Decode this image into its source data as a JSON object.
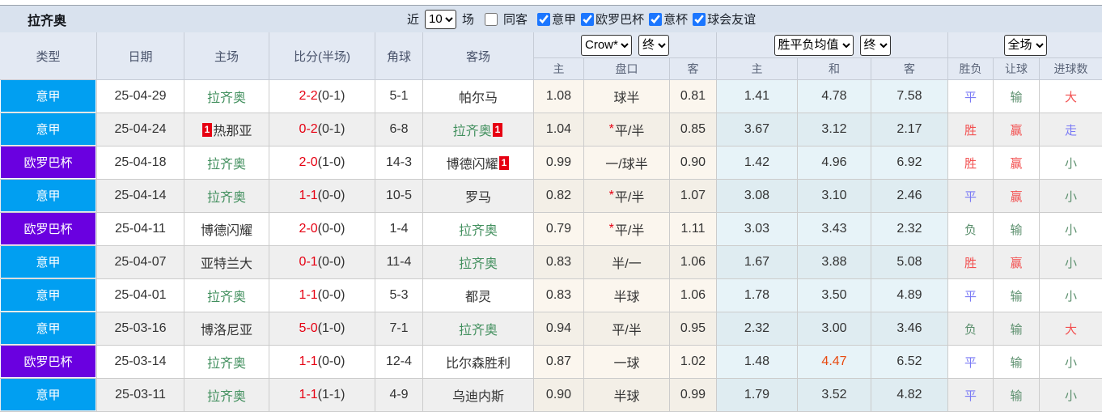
{
  "title": "拉齐奥",
  "controls": {
    "recent_label": "近",
    "recent_value": "10",
    "games_label": "场",
    "same_opponent_label": "同客",
    "same_opponent_checked": false,
    "leagues": [
      {
        "label": "意甲",
        "checked": true
      },
      {
        "label": "欧罗巴杯",
        "checked": true
      },
      {
        "label": "意杯",
        "checked": true
      },
      {
        "label": "球会友谊",
        "checked": true
      }
    ]
  },
  "header": {
    "type": "类型",
    "date": "日期",
    "home": "主场",
    "score": "比分(半场)",
    "corner": "角球",
    "away": "客场",
    "odds_group": {
      "bookmaker": "Crow*",
      "time": "终",
      "sub": [
        "主",
        "盘口",
        "客"
      ]
    },
    "avg_group": {
      "name": "胜平负均值",
      "time": "终",
      "sub": [
        "主",
        "和",
        "客"
      ]
    },
    "result_group": {
      "scope": "全场",
      "sub": [
        "胜负",
        "让球",
        "进球数"
      ]
    }
  },
  "colors": {
    "league_blue": "#019ff1",
    "league_purple": "#6a00e0",
    "score_red": "#e60012",
    "tracked_team_green": "#43905f",
    "result_red": "#f25050",
    "result_blue": "#7a7af5",
    "result_green": "#5b8f6d",
    "hot_value_orange": "#e8490f",
    "title_bar_bg": "#d9e2ee",
    "header_bg": "#e3e9f3",
    "odds_col_bg": "#fbf6ee",
    "avg_col_bg": "#e7f3f8"
  },
  "table": {
    "rows": [
      {
        "league": "意甲",
        "league_style": "blue",
        "date": "25-04-29",
        "home": "拉齐奥",
        "home_tracked": true,
        "home_card": "",
        "score": "2-2",
        "half": "(0-1)",
        "corner": "5-1",
        "away": "帕尔马",
        "away_tracked": false,
        "away_card": "",
        "odds": [
          "1.08",
          "球半",
          "0.81"
        ],
        "handicap_star": false,
        "avg": [
          "1.41",
          "4.78",
          "7.58"
        ],
        "avg_hot": false,
        "results": [
          [
            "平",
            "blue"
          ],
          [
            "输",
            "green"
          ],
          [
            "大",
            "red"
          ]
        ]
      },
      {
        "league": "意甲",
        "league_style": "blue",
        "date": "25-04-24",
        "home": "热那亚",
        "home_tracked": false,
        "home_card": "left",
        "score": "0-2",
        "half": "(0-1)",
        "corner": "6-8",
        "away": "拉齐奥",
        "away_tracked": true,
        "away_card": "right",
        "odds": [
          "1.04",
          "平/半",
          "0.85"
        ],
        "handicap_star": true,
        "avg": [
          "3.67",
          "3.12",
          "2.17"
        ],
        "avg_hot": false,
        "results": [
          [
            "胜",
            "red"
          ],
          [
            "赢",
            "red"
          ],
          [
            "走",
            "blue"
          ]
        ]
      },
      {
        "league": "欧罗巴杯",
        "league_style": "purple",
        "date": "25-04-18",
        "home": "拉齐奥",
        "home_tracked": true,
        "home_card": "",
        "score": "2-0",
        "half": "(1-0)",
        "corner": "14-3",
        "away": "博德闪耀",
        "away_tracked": false,
        "away_card": "right",
        "odds": [
          "0.99",
          "一/球半",
          "0.90"
        ],
        "handicap_star": false,
        "avg": [
          "1.42",
          "4.96",
          "6.92"
        ],
        "avg_hot": false,
        "results": [
          [
            "胜",
            "red"
          ],
          [
            "赢",
            "red"
          ],
          [
            "小",
            "green"
          ]
        ]
      },
      {
        "league": "意甲",
        "league_style": "blue",
        "date": "25-04-14",
        "home": "拉齐奥",
        "home_tracked": true,
        "home_card": "",
        "score": "1-1",
        "half": "(0-0)",
        "corner": "10-5",
        "away": "罗马",
        "away_tracked": false,
        "away_card": "",
        "odds": [
          "0.82",
          "平/半",
          "1.07"
        ],
        "handicap_star": true,
        "avg": [
          "3.08",
          "3.10",
          "2.46"
        ],
        "avg_hot": false,
        "results": [
          [
            "平",
            "blue"
          ],
          [
            "赢",
            "red"
          ],
          [
            "小",
            "green"
          ]
        ]
      },
      {
        "league": "欧罗巴杯",
        "league_style": "purple",
        "date": "25-04-11",
        "home": "博德闪耀",
        "home_tracked": false,
        "home_card": "",
        "score": "2-0",
        "half": "(0-0)",
        "corner": "1-4",
        "away": "拉齐奥",
        "away_tracked": true,
        "away_card": "",
        "odds": [
          "0.79",
          "平/半",
          "1.11"
        ],
        "handicap_star": true,
        "avg": [
          "3.03",
          "3.43",
          "2.32"
        ],
        "avg_hot": false,
        "results": [
          [
            "负",
            "green"
          ],
          [
            "输",
            "green"
          ],
          [
            "小",
            "green"
          ]
        ]
      },
      {
        "league": "意甲",
        "league_style": "blue",
        "date": "25-04-07",
        "home": "亚特兰大",
        "home_tracked": false,
        "home_card": "",
        "score": "0-1",
        "half": "(0-0)",
        "corner": "11-4",
        "away": "拉齐奥",
        "away_tracked": true,
        "away_card": "",
        "odds": [
          "0.83",
          "半/一",
          "1.06"
        ],
        "handicap_star": false,
        "avg": [
          "1.67",
          "3.88",
          "5.08"
        ],
        "avg_hot": false,
        "results": [
          [
            "胜",
            "red"
          ],
          [
            "赢",
            "red"
          ],
          [
            "小",
            "green"
          ]
        ]
      },
      {
        "league": "意甲",
        "league_style": "blue",
        "date": "25-04-01",
        "home": "拉齐奥",
        "home_tracked": true,
        "home_card": "",
        "score": "1-1",
        "half": "(0-0)",
        "corner": "5-3",
        "away": "都灵",
        "away_tracked": false,
        "away_card": "",
        "odds": [
          "0.83",
          "半球",
          "1.06"
        ],
        "handicap_star": false,
        "avg": [
          "1.78",
          "3.50",
          "4.89"
        ],
        "avg_hot": false,
        "results": [
          [
            "平",
            "blue"
          ],
          [
            "输",
            "green"
          ],
          [
            "小",
            "green"
          ]
        ]
      },
      {
        "league": "意甲",
        "league_style": "blue",
        "date": "25-03-16",
        "home": "博洛尼亚",
        "home_tracked": false,
        "home_card": "",
        "score": "5-0",
        "half": "(1-0)",
        "corner": "7-1",
        "away": "拉齐奥",
        "away_tracked": true,
        "away_card": "",
        "odds": [
          "0.94",
          "平/半",
          "0.95"
        ],
        "handicap_star": false,
        "avg": [
          "2.32",
          "3.00",
          "3.46"
        ],
        "avg_hot": false,
        "results": [
          [
            "负",
            "green"
          ],
          [
            "输",
            "green"
          ],
          [
            "大",
            "red"
          ]
        ]
      },
      {
        "league": "欧罗巴杯",
        "league_style": "purple",
        "date": "25-03-14",
        "home": "拉齐奥",
        "home_tracked": true,
        "home_card": "",
        "score": "1-1",
        "half": "(0-0)",
        "corner": "12-4",
        "away": "比尔森胜利",
        "away_tracked": false,
        "away_card": "",
        "odds": [
          "0.87",
          "一球",
          "1.02"
        ],
        "handicap_star": false,
        "avg": [
          "1.48",
          "4.47",
          "6.52"
        ],
        "avg_hot": true,
        "results": [
          [
            "平",
            "blue"
          ],
          [
            "输",
            "green"
          ],
          [
            "小",
            "green"
          ]
        ]
      },
      {
        "league": "意甲",
        "league_style": "blue",
        "date": "25-03-11",
        "home": "拉齐奥",
        "home_tracked": true,
        "home_card": "",
        "score": "1-1",
        "half": "(1-1)",
        "corner": "4-9",
        "away": "乌迪内斯",
        "away_tracked": false,
        "away_card": "",
        "odds": [
          "0.90",
          "半球",
          "0.99"
        ],
        "handicap_star": false,
        "avg": [
          "1.79",
          "3.52",
          "4.82"
        ],
        "avg_hot": false,
        "results": [
          [
            "平",
            "blue"
          ],
          [
            "输",
            "green"
          ],
          [
            "小",
            "green"
          ]
        ]
      }
    ]
  }
}
